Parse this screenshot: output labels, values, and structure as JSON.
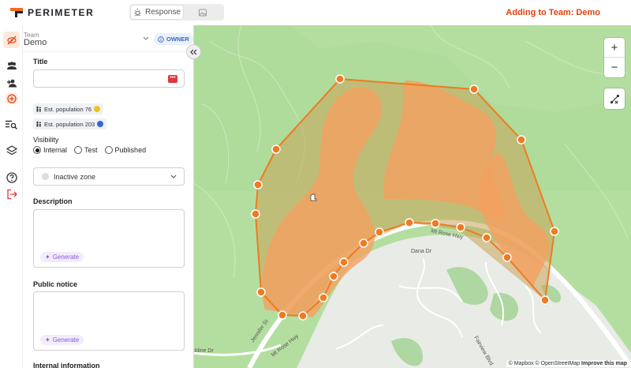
{
  "app": {
    "logo_text": "PERIMETER",
    "adding_to": "Adding to Team: Demo"
  },
  "mode_toggle": {
    "active_label": "Response",
    "active_icon": "sun-icon",
    "other_icon": "image-icon"
  },
  "rail": {
    "icons": [
      "eye-slash-icon",
      "users-icon",
      "user-plus-icon",
      "add-circle-icon",
      "search-list-icon",
      "layers-icon",
      "help-icon",
      "logout-icon"
    ]
  },
  "team": {
    "label": "Team",
    "name": "Demo",
    "role_badge": "OWNER"
  },
  "form": {
    "title_label": "Title",
    "title_value": "",
    "population_chips": [
      {
        "label": "Est. population 76",
        "color": "#f0c419"
      },
      {
        "label": "Est. population 203",
        "color": "#3567d9"
      }
    ],
    "visibility_label": "Visibility",
    "visibility_options": [
      "Internal",
      "Test",
      "Published"
    ],
    "visibility_selected": "Internal",
    "zone_status": "Inactive zone",
    "description_label": "Description",
    "description_value": "",
    "generate_label": "Generate",
    "public_notice_label": "Public notice",
    "public_notice_value": "",
    "internal_info_label": "Internal information"
  },
  "map": {
    "zoom_in": "+",
    "zoom_out": "−",
    "tool_icon": "split-polygon-icon",
    "road_labels": [
      "Mt Rose Hwy",
      "Dana Dr",
      "Jennifer St",
      "Mt Rose Hwy",
      "Geraldine Dr",
      "Fairview Blvd"
    ],
    "attribution": {
      "mapbox": "© Mapbox",
      "osm": "© OpenStreetMap",
      "improve": "Improve this map"
    },
    "polygon_color": "#f07a20",
    "fill_color": "#f5a060"
  }
}
